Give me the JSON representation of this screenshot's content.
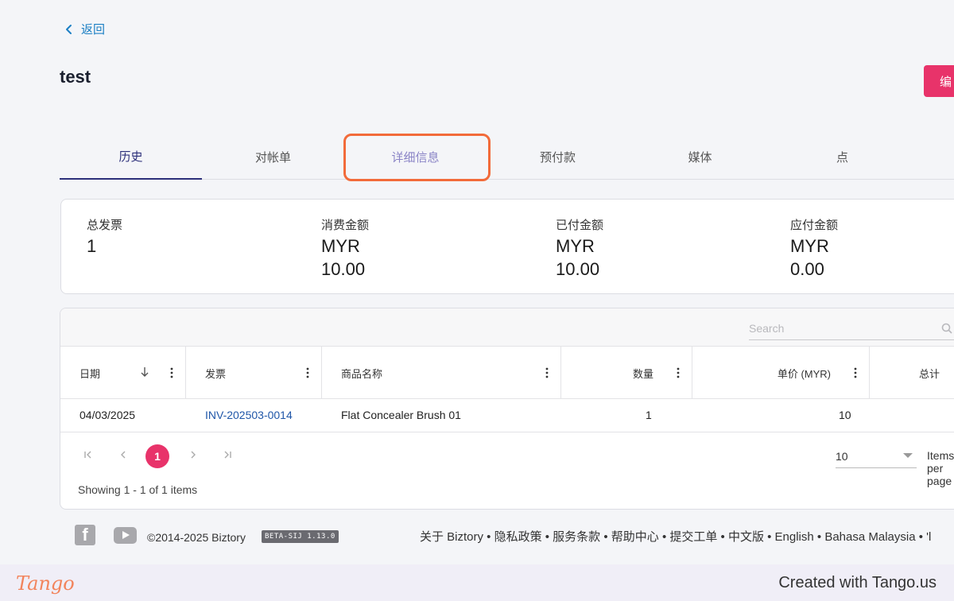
{
  "header": {
    "back_label": "返回",
    "title": "test",
    "edit_label": "编"
  },
  "tabs": [
    {
      "label": "历史",
      "active": true
    },
    {
      "label": "对帐单",
      "active": false
    },
    {
      "label": "详细信息",
      "active": false,
      "highlighted": true
    },
    {
      "label": "预付款",
      "active": false
    },
    {
      "label": "媒体",
      "active": false
    },
    {
      "label": "点",
      "active": false
    }
  ],
  "summary": [
    {
      "label": "总发票",
      "value": "1",
      "value2": ""
    },
    {
      "label": "消费金额",
      "value": "MYR",
      "value2": "10.00"
    },
    {
      "label": "已付金额",
      "value": "MYR",
      "value2": "10.00"
    },
    {
      "label": "应付金额",
      "value": "MYR",
      "value2": "0.00"
    }
  ],
  "grid": {
    "search_placeholder": "Search",
    "columns": [
      "日期",
      "发票",
      "商品名称",
      "数量",
      "单价 (MYR)",
      "总计"
    ],
    "rows": [
      {
        "date": "04/03/2025",
        "invoice": "INV-202503-0014",
        "product": "Flat Concealer Brush 01",
        "qty": "1",
        "unit_price": "10"
      }
    ],
    "pager": {
      "current_page": "1",
      "page_size": "10",
      "items_label": "Items per page",
      "showing": "Showing 1 - 1 of 1 items"
    }
  },
  "footer": {
    "copyright": "©2014-2025 Biztory",
    "version": "BETA-SIJ 1.13.0",
    "links": "关于 Biztory • 隐私政策 • 服务条款 • 帮助中心 • 提交工单 • 中文版 • English • Bahasa Malaysia • 'l"
  },
  "tango": {
    "logo": "Tango",
    "credit": "Created with Tango.us"
  },
  "colors": {
    "accent": "#e8336a",
    "link": "#1f56a8",
    "tab_active": "#2c2f7a",
    "highlight": "#f26b3a"
  }
}
